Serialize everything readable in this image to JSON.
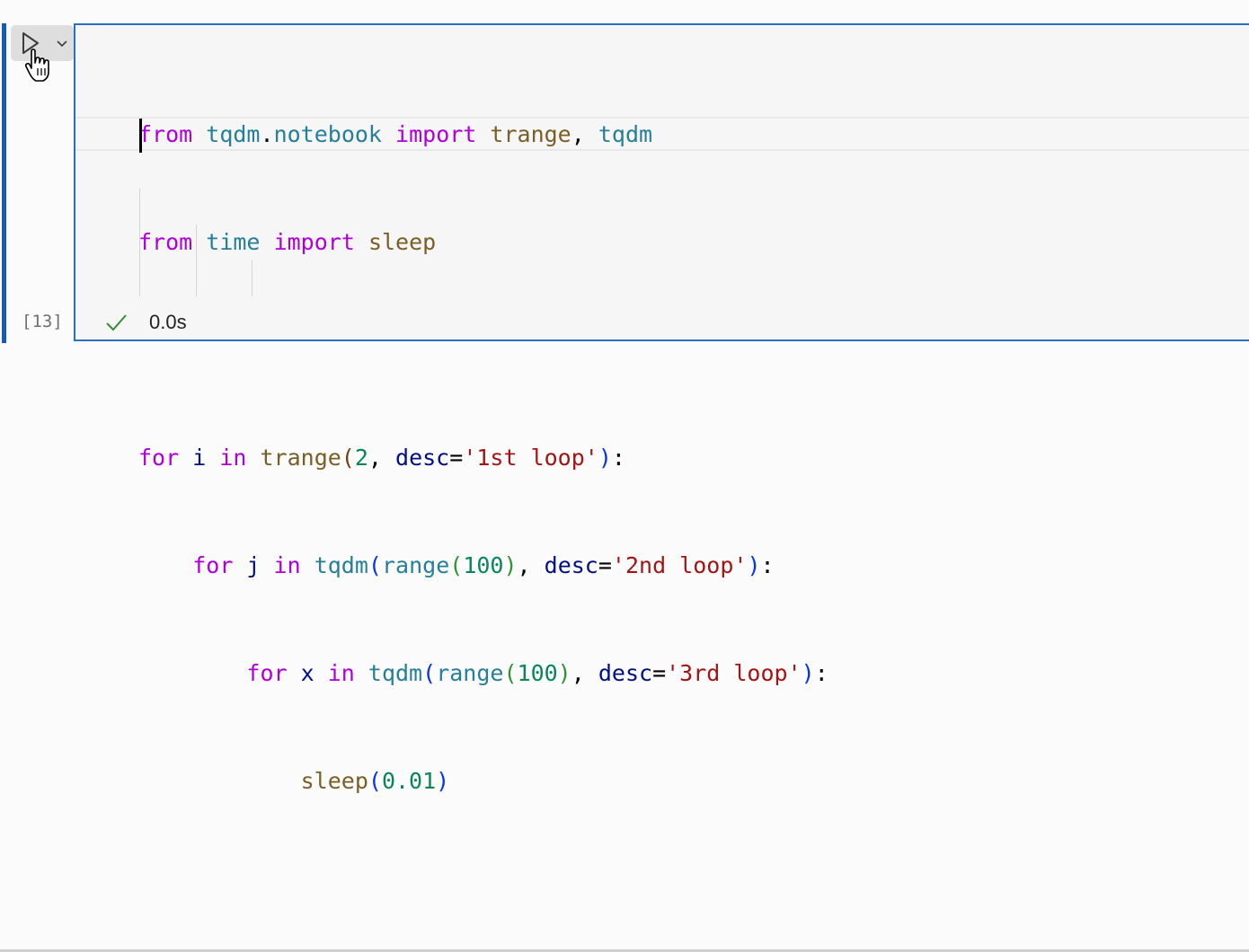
{
  "cell": {
    "execution_count": "[13]",
    "status": "success",
    "duration": "0.0s",
    "run_icon": "play-icon",
    "dropdown_icon": "chevron-down-icon",
    "status_icon": "check-icon",
    "cursor_icon": "hand-pointer-icon"
  },
  "code": {
    "line1": {
      "t1": "from",
      "t2": " ",
      "t3": "tqdm",
      "t4": ".",
      "t5": "notebook",
      "t6": " ",
      "t7": "import",
      "t8": " ",
      "t9": "trange",
      "t10": ", ",
      "t11": "tqdm"
    },
    "line2": {
      "t1": "from",
      "t2": " ",
      "t3": "time",
      "t4": " ",
      "t5": "import",
      "t6": " ",
      "t7": "sleep"
    },
    "line3": "",
    "line4": {
      "t1": "for",
      "t2": " i ",
      "t3": "in",
      "t4": " ",
      "t5": "trange",
      "t6": "(",
      "t7": "2",
      "t8": ", ",
      "t9": "desc",
      "t10": "=",
      "t11": "'1st loop'",
      "t12": ")",
      "t13": ":"
    },
    "line5": {
      "indent": "    ",
      "t1": "for",
      "t2": " j ",
      "t3": "in",
      "t4": " ",
      "t5": "tqdm",
      "t6": "(",
      "t7": "range",
      "t8": "(",
      "t9": "100",
      "t10": ")",
      "t11": ", ",
      "t12": "desc",
      "t13": "=",
      "t14": "'2nd loop'",
      "t15": ")",
      "t16": ":"
    },
    "line6": {
      "indent": "        ",
      "t1": "for",
      "t2": " x ",
      "t3": "in",
      "t4": " ",
      "t5": "tqdm",
      "t6": "(",
      "t7": "range",
      "t8": "(",
      "t9": "100",
      "t10": ")",
      "t11": ", ",
      "t12": "desc",
      "t13": "=",
      "t14": "'3rd loop'",
      "t15": ")",
      "t16": ":"
    },
    "line7": {
      "indent": "            ",
      "t1": "sleep",
      "t2": "(",
      "t3": "0.01",
      "t4": ")"
    }
  },
  "colors": {
    "keyword": "#af00db",
    "module": "#267f99",
    "function": "#795e26",
    "variable": "#001080",
    "number": "#098658",
    "string": "#a31515",
    "focus_border": "#2b6fc2",
    "success": "#388a34"
  }
}
